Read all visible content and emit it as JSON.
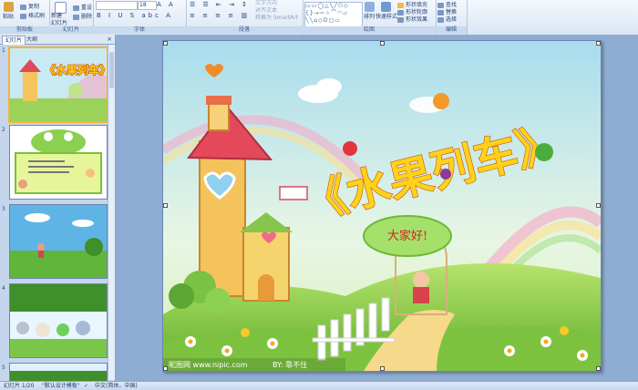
{
  "ribbon": {
    "clipboard": {
      "paste": "粘贴",
      "copy": "复制",
      "format_painter": "格式刷",
      "label": "剪贴板"
    },
    "slides": {
      "new_slide": "新建\n幻灯片",
      "reset": "重设",
      "delete": "删除",
      "label": "幻灯片"
    },
    "font": {
      "size": "18",
      "label": "字体"
    },
    "paragraph": {
      "text_direction": "文字方向",
      "align_text": "对齐文本",
      "smartart": "转换为 SmartArt",
      "label": "段落"
    },
    "drawing": {
      "arrange": "排列",
      "quick_styles": "快速样式",
      "shape_fill": "形状填充",
      "shape_outline": "形状轮廓",
      "shape_effects": "形状效果",
      "label": "绘图"
    },
    "editing": {
      "find": "查找",
      "replace": "替换",
      "select": "选择",
      "label": "编辑"
    }
  },
  "left_pane": {
    "tabs": [
      "幻灯片",
      "大纲"
    ],
    "close": "×",
    "thumbs": [
      {
        "num": "1",
        "title": "《水果列车》"
      },
      {
        "num": "2",
        "title": ""
      },
      {
        "num": "3",
        "title": ""
      },
      {
        "num": "4",
        "title": ""
      },
      {
        "num": "5",
        "title": ""
      }
    ]
  },
  "slide": {
    "title": "《水果列车》",
    "bubble": "大家好!",
    "watermark": "昵图网 www.nipic.com",
    "credit": "BY: 靠不住"
  },
  "status": {
    "slide_count": "幻灯片 1/20",
    "theme": "\"默认设计模板\"",
    "language": "中文(简体，中国)"
  },
  "colors": {
    "sky": "#bfe6f2",
    "grass": "#8ccf4d",
    "title_fill": "#ffd21a",
    "title_stroke": "#c8520e",
    "selection": "#f3b33a"
  }
}
